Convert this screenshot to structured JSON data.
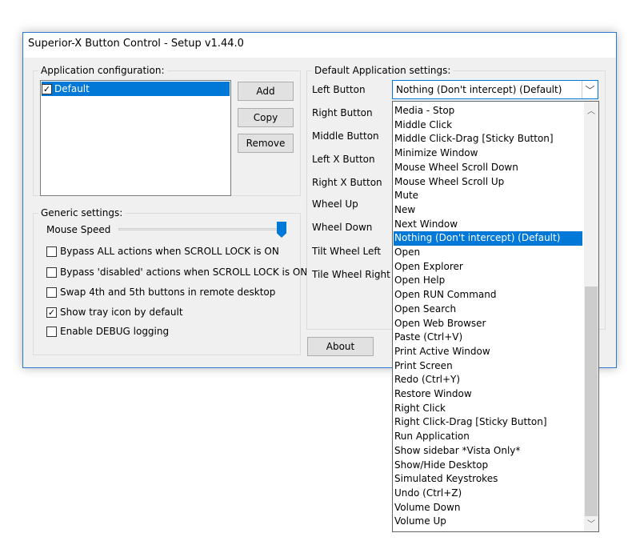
{
  "window": {
    "title": "Superior-X Button Control - Setup v1.44.0"
  },
  "app_config": {
    "legend": "Application configuration:",
    "items": [
      {
        "label": "Default",
        "checked": true,
        "selected": true
      }
    ],
    "add_label": "Add",
    "copy_label": "Copy",
    "remove_label": "Remove"
  },
  "generic": {
    "legend": "Generic settings:",
    "mouse_speed_label": "Mouse Speed",
    "mouse_speed_fraction": 1.0,
    "options": [
      {
        "label": "Bypass ALL actions when SCROLL LOCK is ON",
        "checked": false
      },
      {
        "label": "Bypass 'disabled' actions when SCROLL LOCK is ON",
        "checked": false
      },
      {
        "label": "Swap 4th and 5th buttons in remote desktop",
        "checked": false
      },
      {
        "label": "Show tray icon by default",
        "checked": true
      },
      {
        "label": "Enable DEBUG logging",
        "checked": false
      }
    ]
  },
  "defaults": {
    "legend": "Default Application settings:",
    "buttons": [
      "Left Button",
      "Right Button",
      "Middle Button",
      "Left X Button",
      "Right X Button",
      "Wheel Up",
      "Wheel Down",
      "Tilt Wheel Left",
      "Tile Wheel Right"
    ],
    "left_button_value": "Nothing (Don't intercept) (Default)"
  },
  "about_label": "About",
  "dropdown": {
    "selected_index": 9,
    "items": [
      "Media - Stop",
      "Middle Click",
      "Middle Click-Drag [Sticky Button]",
      "Minimize Window",
      "Mouse Wheel Scroll Down",
      "Mouse Wheel Scroll Up",
      "Mute",
      "New",
      "Next Window",
      "Nothing (Don't intercept) (Default)",
      "Open",
      "Open Explorer",
      "Open Help",
      "Open RUN Command",
      "Open Search",
      "Open Web Browser",
      "Paste (Ctrl+V)",
      "Print Active Window",
      "Print Screen",
      "Redo (Ctrl+Y)",
      "Restore Window",
      "Right Click",
      "Right Click-Drag [Sticky Button]",
      "Run Application",
      "Show sidebar *Vista Only*",
      "Show/Hide Desktop",
      "Simulated Keystrokes",
      "Undo (Ctrl+Z)",
      "Volume Down",
      "Volume Up"
    ]
  }
}
